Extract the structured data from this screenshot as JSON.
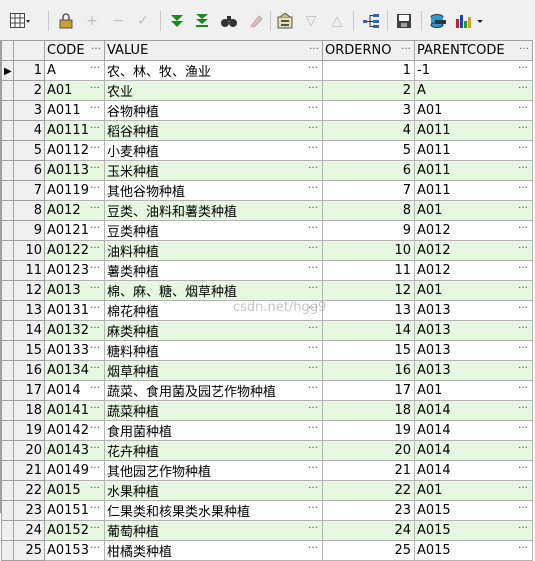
{
  "toolbar": {
    "icons": [
      "grid-menu-icon",
      "lock-icon",
      "add-row-icon",
      "delete-row-icon",
      "post-icon",
      "fetch-next-icon",
      "fetch-last-icon",
      "find-icon",
      "clear-icon",
      "query-by-example-icon",
      "filter-icon",
      "sort-up-icon",
      "tree-icon",
      "save-icon",
      "export-icon",
      "chart-icon"
    ]
  },
  "columns": {
    "code": "CODE",
    "value": "VALUE",
    "orderno": "ORDERNO",
    "parentcode": "PARENTCODE"
  },
  "rows": [
    {
      "n": "1",
      "code": "A",
      "value": "农、林、牧、渔业",
      "order": "1",
      "parent": "-1"
    },
    {
      "n": "2",
      "code": "A01",
      "value": "农业",
      "order": "2",
      "parent": "A"
    },
    {
      "n": "3",
      "code": "A011",
      "value": "谷物种植",
      "order": "3",
      "parent": "A01"
    },
    {
      "n": "4",
      "code": "A0111",
      "value": "稻谷种植",
      "order": "4",
      "parent": "A011"
    },
    {
      "n": "5",
      "code": "A0112",
      "value": "小麦种植",
      "order": "5",
      "parent": "A011"
    },
    {
      "n": "6",
      "code": "A0113",
      "value": "玉米种植",
      "order": "6",
      "parent": "A011"
    },
    {
      "n": "7",
      "code": "A0119",
      "value": "其他谷物种植",
      "order": "7",
      "parent": "A011"
    },
    {
      "n": "8",
      "code": "A012",
      "value": "豆类、油料和薯类种植",
      "order": "8",
      "parent": "A01"
    },
    {
      "n": "9",
      "code": "A0121",
      "value": "豆类种植",
      "order": "9",
      "parent": "A012"
    },
    {
      "n": "10",
      "code": "A0122",
      "value": "油料种植",
      "order": "10",
      "parent": "A012"
    },
    {
      "n": "11",
      "code": "A0123",
      "value": "薯类种植",
      "order": "11",
      "parent": "A012"
    },
    {
      "n": "12",
      "code": "A013",
      "value": "棉、麻、糖、烟草种植",
      "order": "12",
      "parent": "A01"
    },
    {
      "n": "13",
      "code": "A0131",
      "value": "棉花种植",
      "order": "13",
      "parent": "A013"
    },
    {
      "n": "14",
      "code": "A0132",
      "value": "麻类种植",
      "order": "14",
      "parent": "A013"
    },
    {
      "n": "15",
      "code": "A0133",
      "value": "糖料种植",
      "order": "15",
      "parent": "A013"
    },
    {
      "n": "16",
      "code": "A0134",
      "value": "烟草种植",
      "order": "16",
      "parent": "A013"
    },
    {
      "n": "17",
      "code": "A014",
      "value": "蔬菜、食用菌及园艺作物种植",
      "order": "17",
      "parent": "A01"
    },
    {
      "n": "18",
      "code": "A0141",
      "value": "蔬菜种植",
      "order": "18",
      "parent": "A014"
    },
    {
      "n": "19",
      "code": "A0142",
      "value": "食用菌种植",
      "order": "19",
      "parent": "A014"
    },
    {
      "n": "20",
      "code": "A0143",
      "value": "花卉种植",
      "order": "20",
      "parent": "A014"
    },
    {
      "n": "21",
      "code": "A0149",
      "value": "其他园艺作物种植",
      "order": "21",
      "parent": "A014"
    },
    {
      "n": "22",
      "code": "A015",
      "value": "水果种植",
      "order": "22",
      "parent": "A01"
    },
    {
      "n": "23",
      "code": "A0151",
      "value": "仁果类和核果类水果种植",
      "order": "23",
      "parent": "A015"
    },
    {
      "n": "24",
      "code": "A0152",
      "value": "葡萄种植",
      "order": "24",
      "parent": "A015"
    },
    {
      "n": "25",
      "code": "A0153",
      "value": "柑橘类种植",
      "order": "25",
      "parent": "A015"
    }
  ],
  "watermark": "csdn.net/hgg9"
}
